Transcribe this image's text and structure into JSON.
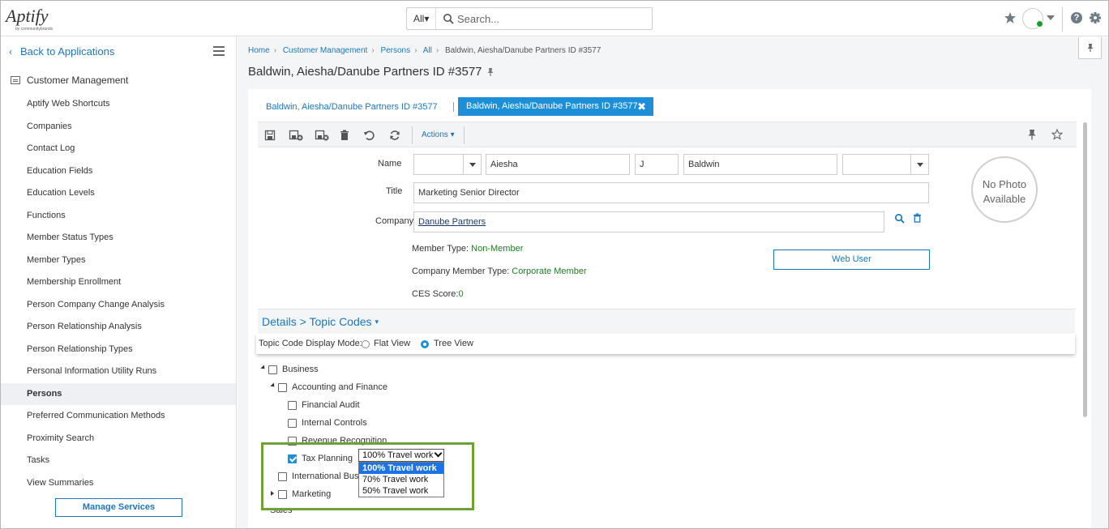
{
  "topbar": {
    "logo_text": "Aptify",
    "logo_sub": "by communitybrands",
    "search_scope": "All",
    "search_placeholder": "Search...",
    "help_glyph": "?"
  },
  "sidebar": {
    "back_label": "Back to Applications",
    "section_title": "Customer Management",
    "items": [
      {
        "label": "Aptify Web Shortcuts",
        "active": false
      },
      {
        "label": "Companies",
        "active": false
      },
      {
        "label": "Contact Log",
        "active": false
      },
      {
        "label": "Education Fields",
        "active": false
      },
      {
        "label": "Education Levels",
        "active": false
      },
      {
        "label": "Functions",
        "active": false
      },
      {
        "label": "Member Status Types",
        "active": false
      },
      {
        "label": "Member Types",
        "active": false
      },
      {
        "label": "Membership Enrollment",
        "active": false
      },
      {
        "label": "Person Company Change Analysis",
        "active": false
      },
      {
        "label": "Person Relationship Analysis",
        "active": false
      },
      {
        "label": "Person Relationship Types",
        "active": false
      },
      {
        "label": "Personal Information Utility Runs",
        "active": false
      },
      {
        "label": "Persons",
        "active": true
      },
      {
        "label": "Preferred Communication Methods",
        "active": false
      },
      {
        "label": "Proximity Search",
        "active": false
      },
      {
        "label": "Tasks",
        "active": false
      },
      {
        "label": "View Summaries",
        "active": false
      }
    ],
    "manage_services_label": "Manage Services"
  },
  "breadcrumb": {
    "items": [
      "Home",
      "Customer Management",
      "Persons",
      "All"
    ],
    "current": "Baldwin, Aiesha/Danube Partners ID #3577"
  },
  "page": {
    "title": "Baldwin, Aiesha/Danube Partners ID #3577"
  },
  "tabs": {
    "tab1": "Baldwin, Aiesha/Danube Partners ID #3577",
    "tab2": "Baldwin, Aiesha/Danube Partners ID #3577",
    "close_glyph": "✖"
  },
  "toolbar": {
    "actions_label": "Actions ▾"
  },
  "form": {
    "name_label": "Name",
    "prefix": "",
    "first_name": "Aiesha",
    "middle": "J",
    "last_name": "Baldwin",
    "suffix": "",
    "title_label": "Title",
    "title_value": "Marketing Senior Director",
    "company_label": "Company",
    "company_value": "Danube Partners",
    "member_type_label": "Member Type: ",
    "member_type_value": "Non-Member",
    "company_member_type_label": "Company Member Type: ",
    "company_member_type_value": "Corporate Member",
    "ces_score_label": "CES Score:",
    "ces_score_value": "0",
    "web_user_label": "Web User",
    "photo_text": "No Photo Available"
  },
  "details": {
    "title": "Details > Topic Codes",
    "caret": "▾",
    "mode_label": "Topic Code Display Mode:",
    "flat_view": "Flat View",
    "tree_view": "Tree View",
    "selected_mode": "Tree View"
  },
  "tree": {
    "business": "Business",
    "accounting": "Accounting and Finance",
    "financial_audit": "Financial Audit",
    "internal_controls": "Internal Controls",
    "revenue_recognition": "Revenue Recognition",
    "tax_planning": "Tax Planning",
    "international": "International Busi",
    "marketing": "Marketing",
    "sales_partial": "Sales"
  },
  "dropdown": {
    "selected": "100% Travel work",
    "options": [
      "100% Travel work",
      "70% Travel work",
      "50% Travel work"
    ]
  },
  "colors": {
    "accent": "#1d76bb",
    "tab_active": "#1d8fd8",
    "highlight_border": "#6ba233",
    "value_green": "#237a23"
  }
}
